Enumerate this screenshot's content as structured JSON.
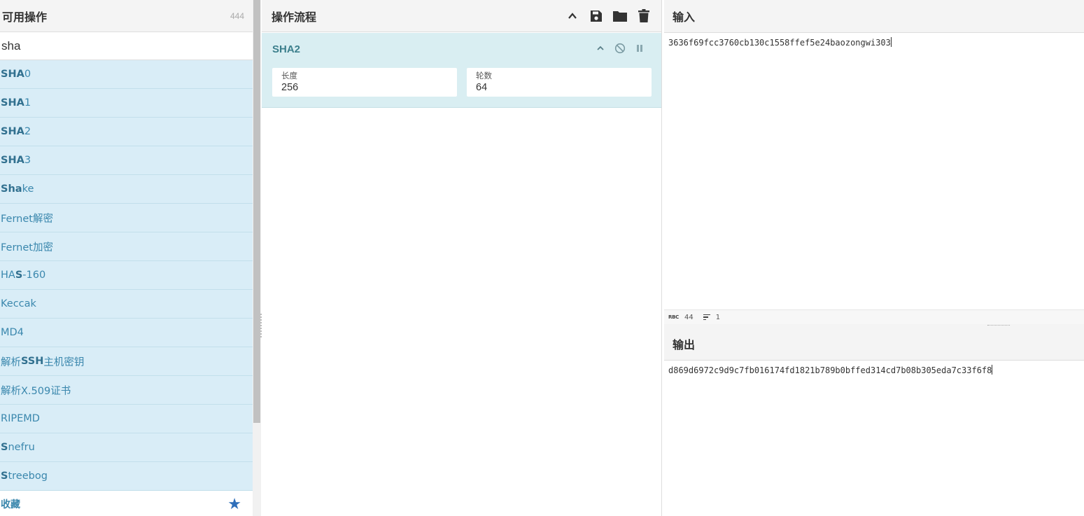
{
  "operations": {
    "title": "可用操作",
    "count": "444",
    "search_value": "sha",
    "items": [
      {
        "match": "SHA",
        "rest": "0"
      },
      {
        "match": "SHA",
        "rest": "1"
      },
      {
        "match": "SHA",
        "rest": "2"
      },
      {
        "match": "SHA",
        "rest": "3"
      },
      {
        "match": "Sha",
        "rest": "ke"
      },
      {
        "pre": "Fernet解密"
      },
      {
        "pre": "Fernet加密"
      },
      {
        "pre": "HA",
        "match": "S",
        "rest": "-160"
      },
      {
        "pre": "Keccak"
      },
      {
        "pre": "MD4"
      },
      {
        "pre": "解析",
        "match": "SSH",
        "rest": "主机密钥"
      },
      {
        "pre": "解析X.509证书"
      },
      {
        "pre": "RIPEMD"
      },
      {
        "match": "S",
        "rest": "nefru"
      },
      {
        "match": "S",
        "rest": "treebog"
      }
    ],
    "favourites_label": "收藏",
    "star_icon": "star-icon"
  },
  "recipe": {
    "title": "操作流程",
    "header_icons": [
      "chevron-up-icon",
      "save-icon",
      "folder-icon",
      "trash-icon"
    ],
    "operation": {
      "name": "SHA2",
      "args": [
        {
          "label": "长度",
          "value": "256"
        },
        {
          "label": "轮数",
          "value": "64"
        }
      ]
    }
  },
  "input": {
    "title": "输入",
    "text": "3636f69fcc3760cb130c1558ffef5e24baozongwi303",
    "status": {
      "length_label": "RBC",
      "length": "44",
      "lines": "1"
    }
  },
  "output": {
    "title": "输出",
    "text": "d869d6972c9d9c7fb016174fd1821b789b0bffed314cd7b08b305eda7c33f6f8"
  },
  "colors": {
    "op_bg": "#d9edf7",
    "op_text": "#3a87ad",
    "recipe_card_bg": "#d9eef2",
    "star": "#2f6fba"
  }
}
